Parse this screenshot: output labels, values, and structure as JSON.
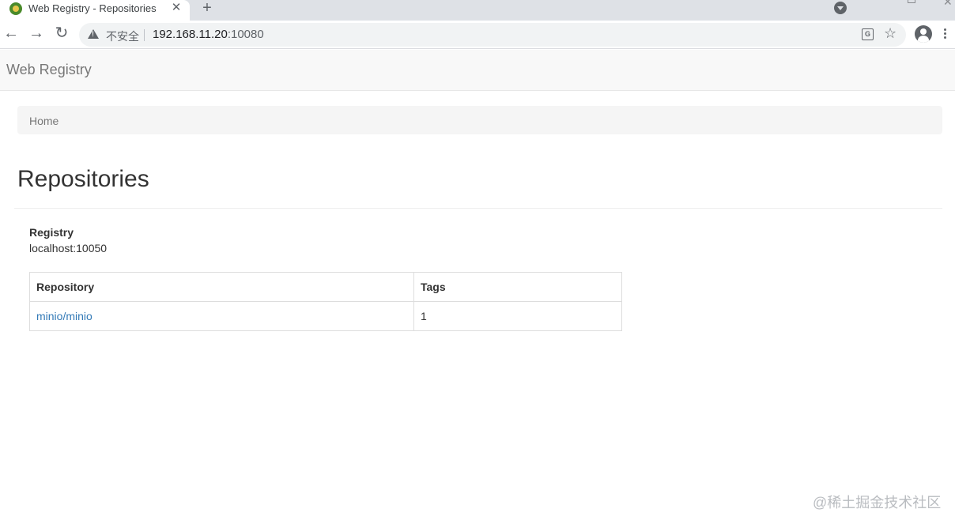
{
  "browser": {
    "tab_title": "Web Registry - Repositories",
    "tab_close": "✕",
    "new_tab": "+",
    "nav_back": "←",
    "nav_forward": "→",
    "nav_reload": "↻",
    "security_label": "不安全",
    "url_host": "192.168.11.20",
    "url_port": ":10080",
    "translate_glyph": "G",
    "star": "☆",
    "window_close": "✕"
  },
  "navbar": {
    "brand": "Web Registry"
  },
  "breadcrumb": {
    "items": [
      "Home"
    ]
  },
  "page": {
    "title": "Repositories",
    "registry_label": "Registry",
    "registry_value": "localhost:10050"
  },
  "table": {
    "headers": [
      "Repository",
      "Tags"
    ],
    "rows": [
      {
        "repository": "minio/minio",
        "tags": "1"
      }
    ]
  },
  "watermark": "@稀土掘金技术社区",
  "colors": {
    "link": "#337ab7",
    "navbar_bg": "#f8f8f8",
    "breadcrumb_bg": "#f5f5f5",
    "tabstrip_bg": "#dee1e6"
  },
  "icons": [
    "favicon-icon",
    "close-icon",
    "plus-icon",
    "tab-search-icon",
    "back-arrow-icon",
    "forward-arrow-icon",
    "reload-icon",
    "warning-icon",
    "translate-icon",
    "star-icon",
    "profile-icon",
    "menu-icon"
  ]
}
